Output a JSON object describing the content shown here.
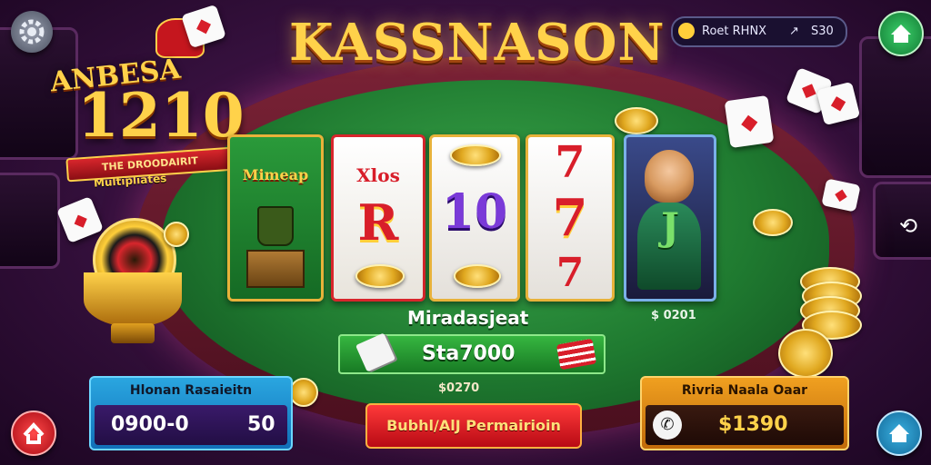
{
  "title": "KASSNASON",
  "logo": {
    "top_text": "ANBESA",
    "number": "1210",
    "ribbon_text": "THE DROODAIRIT",
    "sub_text": "Multipliates"
  },
  "top_info": {
    "text": "Roet RHNX",
    "arrow": "↗",
    "value": "S30"
  },
  "reels": [
    {
      "label_top": "Mimeap",
      "symbols": [
        "bag",
        "crate"
      ]
    },
    {
      "label_top": "Xlos",
      "symbols": [
        "R",
        "coin"
      ]
    },
    {
      "label_top": "",
      "symbols": [
        "10"
      ]
    },
    {
      "label_top": "",
      "symbols": [
        "7",
        "7",
        "7"
      ]
    },
    {
      "label_top": "",
      "symbols": [
        "J"
      ]
    }
  ],
  "reel_symbols": {
    "r1_mid": "Mimeap",
    "r2_top": "Xlos",
    "r2_mid": "R",
    "r3_mid": "10",
    "r4_top": "7",
    "r4_mid": "7",
    "r4_bot": "7",
    "r5_mid": "J"
  },
  "mid_label": "Miradasjeat",
  "side_value": "$ 0201",
  "bet": {
    "value": "Sta7000"
  },
  "below_bet": "$0270",
  "left_panel": {
    "header": "Hlonan Rasaieitn",
    "value_left": "0900-0",
    "value_right": "50"
  },
  "right_panel": {
    "header": "Rivria Naala Oaar",
    "value": "$1390"
  },
  "action_button": "Bubhl/AlJ Permairioin",
  "colors": {
    "felt": "#2a8a3a",
    "rim": "#6a1a2c",
    "gold": "#ffd24a",
    "background": "#3a1242"
  },
  "icons": [
    "settings-icon",
    "home-icon",
    "back-icon",
    "phone-icon",
    "coin-icon",
    "refresh-icon"
  ]
}
